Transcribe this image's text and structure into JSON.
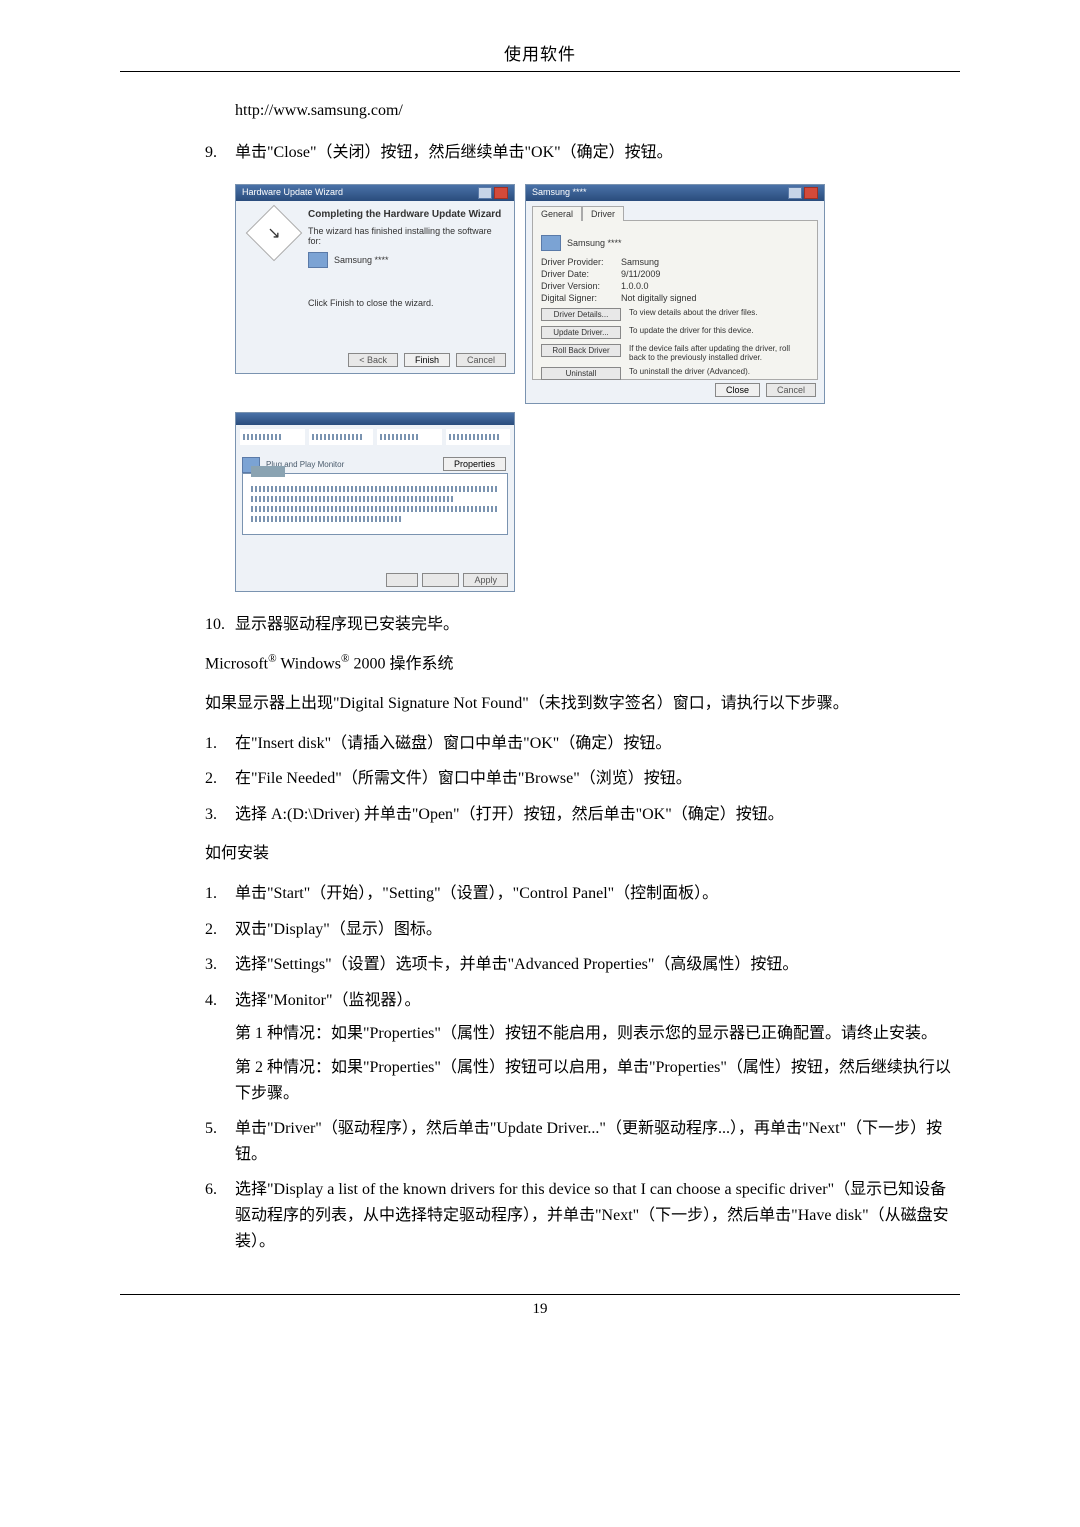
{
  "header": {
    "title": "使用软件"
  },
  "first_url": "http://www.samsung.com/",
  "steps_a": {
    "n9": "9.",
    "t9": "单击\"Close\"（关闭）按钮，然后继续单击\"OK\"（确定）按钮。",
    "n10": "10.",
    "t10": "显示器驱动程序现已安装完毕。"
  },
  "os_heading": {
    "pre": "Microsoft",
    "mid": " Windows",
    "post": " 2000 操作系统",
    "sup": "®"
  },
  "dsnf": "如果显示器上出现\"Digital Signature Not Found\"（未找到数字签名）窗口，请执行以下步骤。",
  "steps_b": [
    {
      "n": "1.",
      "t": "在\"Insert disk\"（请插入磁盘）窗口中单击\"OK\"（确定）按钮。"
    },
    {
      "n": "2.",
      "t": "在\"File Needed\"（所需文件）窗口中单击\"Browse\"（浏览）按钮。"
    },
    {
      "n": "3.",
      "t": "选择 A:(D:\\Driver) 并单击\"Open\"（打开）按钮，然后单击\"OK\"（确定）按钮。"
    }
  ],
  "howto": "如何安装",
  "steps_c": [
    {
      "n": "1.",
      "t": "单击\"Start\"（开始），\"Setting\"（设置），\"Control Panel\"（控制面板）。"
    },
    {
      "n": "2.",
      "t": "双击\"Display\"（显示）图标。"
    },
    {
      "n": "3.",
      "t": "选择\"Settings\"（设置）选项卡，并单击\"Advanced Properties\"（高级属性）按钮。"
    },
    {
      "n": "4.",
      "t": "选择\"Monitor\"（监视器）。",
      "sub": [
        "第 1 种情况：如果\"Properties\"（属性）按钮不能启用，则表示您的显示器已正确配置。请终止安装。",
        "第 2 种情况：如果\"Properties\"（属性）按钮可以启用，单击\"Properties\"（属性）按钮，然后继续执行以下步骤。"
      ]
    },
    {
      "n": "5.",
      "t": "单击\"Driver\"（驱动程序），然后单击\"Update Driver...\"（更新驱动程序...），再单击\"Next\"（下一步）按钮。"
    },
    {
      "n": "6.",
      "t": "选择\"Display a list of the known drivers for this device so that I can choose a specific driver\"（显示已知设备驱动程序的列表，从中选择特定驱动程序），并单击\"Next\"（下一步），然后单击\"Have disk\"（从磁盘安装）。"
    }
  ],
  "dialogs": {
    "hw_update": {
      "title": "Hardware Update Wizard",
      "heading": "Completing the Hardware Update Wizard",
      "line1": "The wizard has finished installing the software for:",
      "device": "Samsung ****",
      "line2": "Click Finish to close the wizard.",
      "btn_back": "< Back",
      "btn_finish": "Finish",
      "btn_cancel": "Cancel"
    },
    "properties": {
      "title": "Samsung ****",
      "tab_general": "General",
      "tab_driver": "Driver",
      "device": "Samsung ****",
      "rows": [
        {
          "label": "Driver Provider:",
          "value": "Samsung"
        },
        {
          "label": "Driver Date:",
          "value": "9/11/2009"
        },
        {
          "label": "Driver Version:",
          "value": "1.0.0.0"
        },
        {
          "label": "Digital Signer:",
          "value": "Not digitally signed"
        }
      ],
      "buttons": [
        {
          "label": "Driver Details...",
          "desc": "To view details about the driver files."
        },
        {
          "label": "Update Driver...",
          "desc": "To update the driver for this device."
        },
        {
          "label": "Roll Back Driver",
          "desc": "If the device fails after updating the driver, roll back to the previously installed driver."
        },
        {
          "label": "Uninstall",
          "desc": "To uninstall the driver (Advanced)."
        }
      ],
      "btn_close": "Close",
      "btn_cancel": "Cancel"
    },
    "fuzzy": {
      "device_label": "Plug and Play Monitor",
      "btn_properties": "Properties",
      "btn_apply": "Apply"
    }
  },
  "page_number": "19"
}
